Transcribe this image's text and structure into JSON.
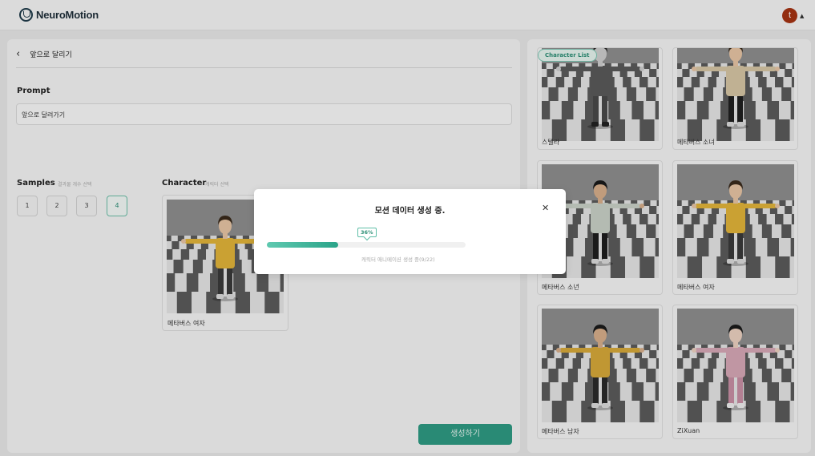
{
  "header": {
    "app_name": "NeuroMotion",
    "user_initial": "t"
  },
  "editor": {
    "back_title": "앞으로 달리기",
    "prompt_label": "Prompt",
    "prompt_value": "앞으로 달려가기",
    "samples_label": "Samples",
    "samples_hint": "결과물 개수 선택",
    "samples": [
      "1",
      "2",
      "3",
      "4"
    ],
    "samples_selected": "4",
    "character_label": "Character",
    "character_hint": "캐릭터 선택",
    "selected_character": "메타버스 여자",
    "generate_label": "생성하기"
  },
  "character_list": {
    "tag": "Character List",
    "items": [
      {
        "name": "스텔라"
      },
      {
        "name": "메타버스 소녀"
      },
      {
        "name": "메타버스 소년"
      },
      {
        "name": "메타버스 여자"
      },
      {
        "name": "메타버스 남자"
      },
      {
        "name": "ZiXuan"
      }
    ]
  },
  "modal": {
    "title": "모션 데이터 생성 중.",
    "progress_percent": 36,
    "progress_label": "36%",
    "status": "캐릭터 애니메이션 생성 중(9/22)"
  },
  "colors": {
    "accent": "#2f9c84",
    "avatar": "#a63312"
  }
}
